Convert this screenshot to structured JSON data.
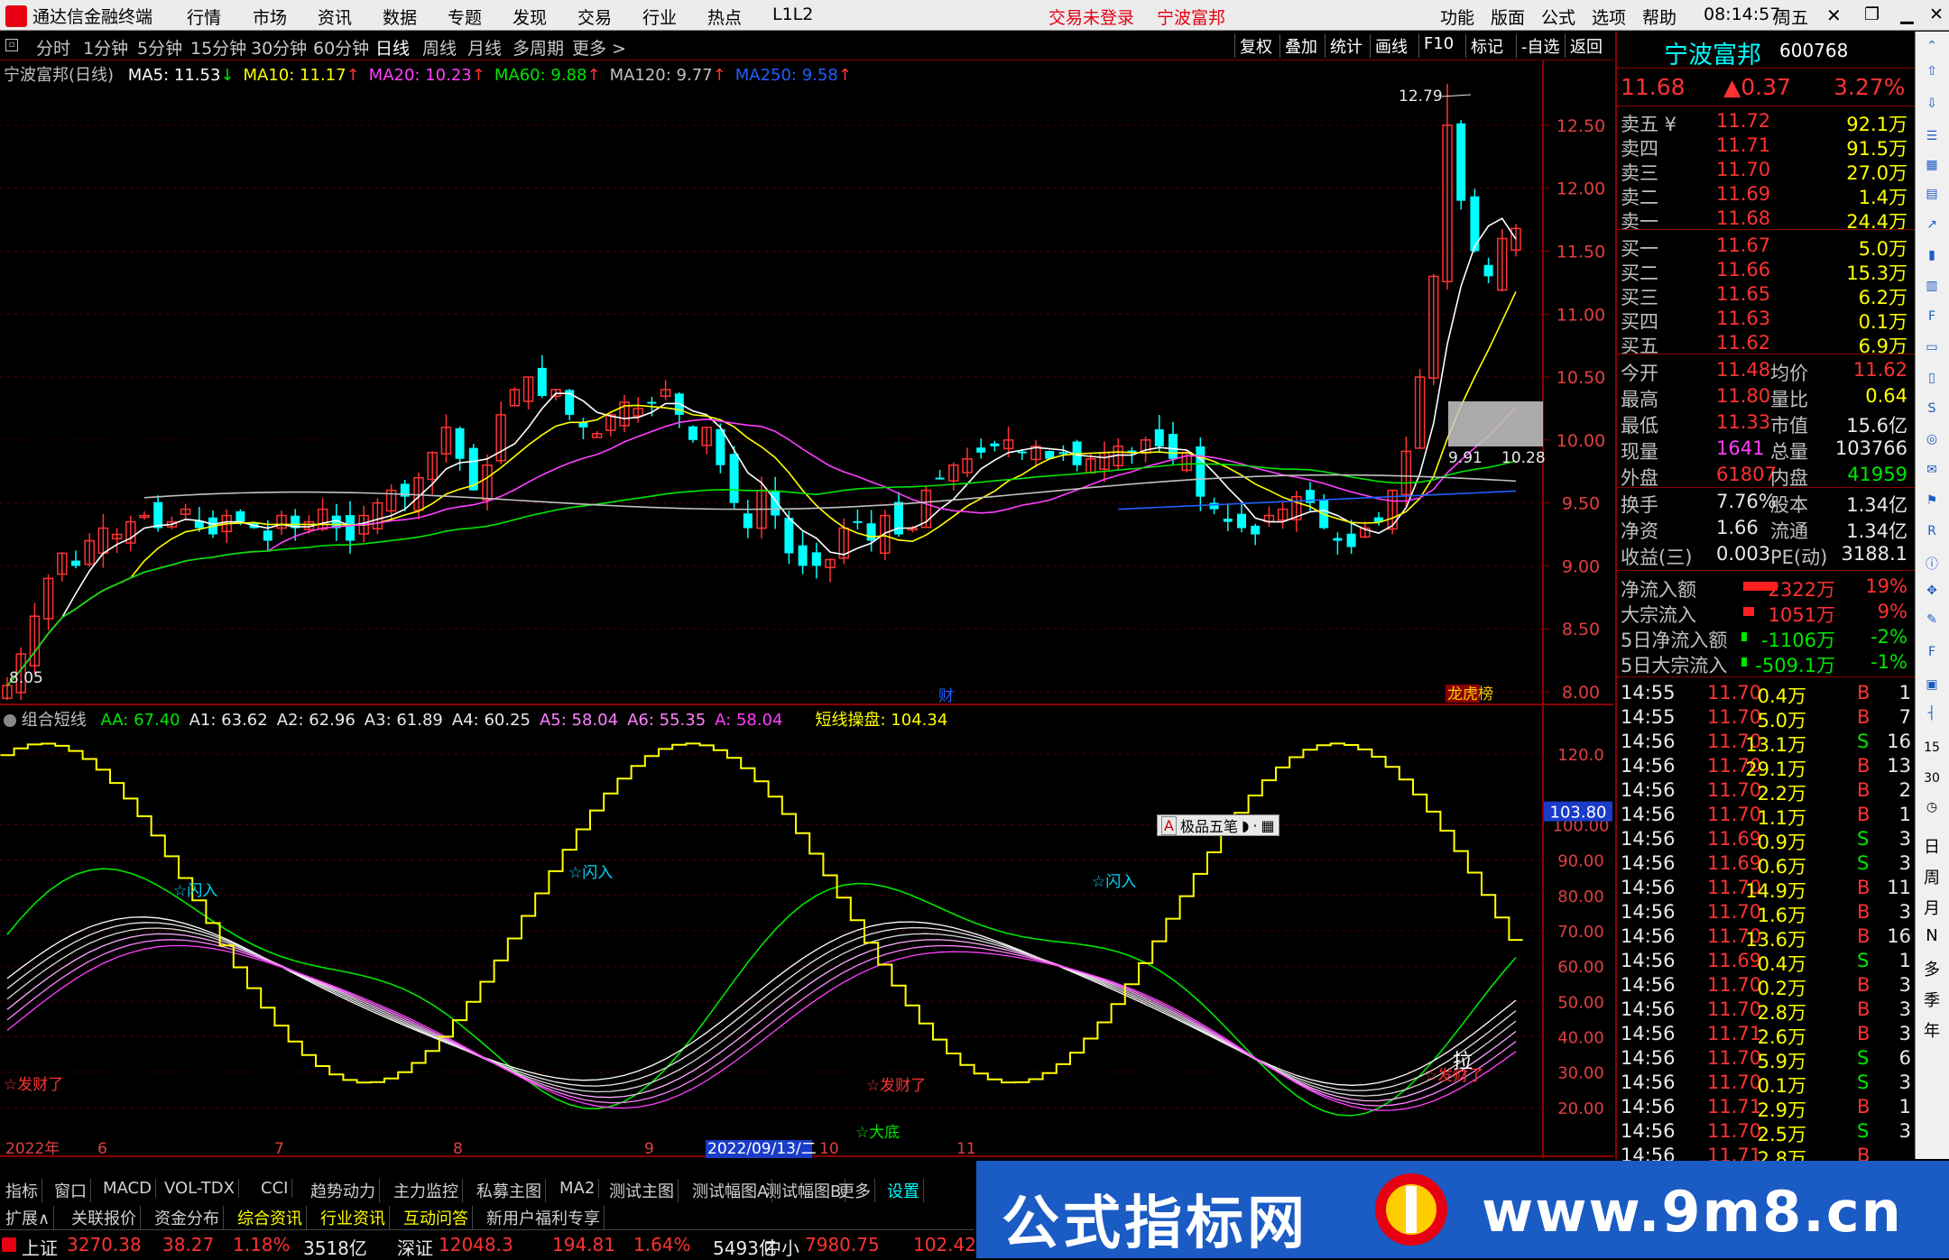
{
  "app": {
    "name": "通达信金融终端"
  },
  "menu": {
    "items": [
      "行情",
      "市场",
      "资讯",
      "数据",
      "专题",
      "发现",
      "交易",
      "行业",
      "热点",
      "L1L2"
    ],
    "alert": "交易未登录",
    "stock_link": "宁波富邦",
    "right_items": [
      "功能",
      "版面",
      "公式",
      "选项",
      "帮助"
    ],
    "time": "08:14:57",
    "weekday": "周五"
  },
  "periods": {
    "items": [
      "分时",
      "1分钟",
      "5分钟",
      "15分钟",
      "30分钟",
      "60分钟",
      "日线",
      "周线",
      "月线",
      "多周期",
      "更多 >"
    ],
    "selected": "日线",
    "right_buttons": [
      "复权",
      "叠加",
      "统计",
      "画线",
      "F10",
      "标记",
      "-自选",
      "返回"
    ]
  },
  "chart": {
    "main_label": "宁波富邦(日线)",
    "ma_items": [
      {
        "label": "MA5: 11.53",
        "arrow": "↓",
        "color": "#ffffff"
      },
      {
        "label": "MA10: 11.17",
        "arrow": "↑",
        "color": "#ffff00"
      },
      {
        "label": "MA20: 10.23",
        "arrow": "↑",
        "color": "#ff40ff"
      },
      {
        "label": "MA60: 9.88",
        "arrow": "↑",
        "color": "#00e600"
      },
      {
        "label": "MA120: 9.77",
        "arrow": "↑",
        "color": "#c0c0c0"
      },
      {
        "label": "MA250: 9.58",
        "arrow": "↑",
        "color": "#2060ff"
      }
    ],
    "price_axis": [
      "12.50",
      "12.00",
      "11.50",
      "11.00",
      "10.50",
      "10.00",
      "9.50",
      "9.00",
      "8.50",
      "8.00"
    ],
    "high_label": "12.79",
    "low_label": "8.05",
    "label_991": "9.91",
    "label_1028": "10.28",
    "marker_cai": "财",
    "marker_bang": "龙虎榜",
    "sub_label": "组合短线",
    "sub_items": [
      {
        "label": "AA: 67.40",
        "color": "#00e600"
      },
      {
        "label": "A1: 63.62",
        "color": "#e8e8e8"
      },
      {
        "label": "A2: 62.96",
        "color": "#e8e8e8"
      },
      {
        "label": "A3: 61.89",
        "color": "#e8e8e8"
      },
      {
        "label": "A4: 60.25",
        "color": "#e8e8e8"
      },
      {
        "label": "A5: 58.04",
        "color": "#ff80ff"
      },
      {
        "label": "A6: 55.35",
        "color": "#ff80ff"
      },
      {
        "label": "A: 58.04",
        "color": "#ff40ff"
      },
      {
        "label": "短线操盘: 104.34",
        "color": "#ffff00"
      }
    ],
    "sub_axis": [
      "120.0",
      "100.00",
      "90.00",
      "80.00",
      "70.00",
      "60.00",
      "50.00",
      "40.00",
      "30.00",
      "20.00"
    ],
    "sub_current": "103.80",
    "annotations": [
      "☆闪入",
      "☆闪入",
      "☆闪入",
      "☆发财了",
      "☆发财了",
      "☆发财了",
      "☆大底",
      "拉"
    ],
    "popup": "极品五笔",
    "date_axis": [
      "2022年",
      "6",
      "7",
      "8",
      "9",
      "2022/09/13/二",
      "10",
      "11"
    ]
  },
  "chart_data": {
    "type": "candlestick",
    "ylim": [
      8.0,
      12.8
    ],
    "closes": [
      8.05,
      8.3,
      8.6,
      8.9,
      9.1,
      9.0,
      9.2,
      9.3,
      9.25,
      9.35,
      9.4,
      9.3,
      9.35,
      9.45,
      9.3,
      9.25,
      9.4,
      9.35,
      9.3,
      9.2,
      9.4,
      9.3,
      9.35,
      9.45,
      9.3,
      9.2,
      9.4,
      9.5,
      9.6,
      9.55,
      9.7,
      9.9,
      10.1,
      9.85,
      9.6,
      9.8,
      10.2,
      10.4,
      10.5,
      10.35,
      10.4,
      10.2,
      10.1,
      10.05,
      10.2,
      10.3,
      10.25,
      10.3,
      10.4,
      10.2,
      10.0,
      10.1,
      9.8,
      9.5,
      9.3,
      9.6,
      9.4,
      9.1,
      9.0,
      9.0,
      9.05,
      9.3,
      9.35,
      9.2,
      9.4,
      9.25,
      9.3,
      9.6,
      9.7,
      9.8,
      9.85,
      9.9,
      9.95,
      10.0,
      9.9,
      9.95,
      9.85,
      9.9,
      9.8,
      9.85,
      9.9,
      9.95,
      9.9,
      10.0,
      9.95,
      9.85,
      9.9,
      9.55,
      9.45,
      9.35,
      9.3,
      9.25,
      9.4,
      9.45,
      9.55,
      9.5,
      9.3,
      9.2,
      9.15,
      9.3,
      9.35,
      9.6,
      9.91,
      10.5,
      11.3,
      12.5,
      11.9,
      11.5,
      11.3,
      11.6,
      11.68
    ],
    "ma_series": [
      "MA5",
      "MA10",
      "MA20",
      "MA60",
      "MA120",
      "MA250"
    ],
    "sub_series": [
      "AA",
      "A1",
      "A2",
      "A3",
      "A4",
      "A5",
      "A6",
      "A",
      "短线操盘"
    ],
    "sub_ylim": [
      10,
      130
    ]
  },
  "quote": {
    "name": "宁波富邦",
    "code": "600768",
    "price": "11.68",
    "change": "▲0.37",
    "pct": "3.27%",
    "asks": [
      {
        "label": "卖五",
        "price": "11.72",
        "vol": "92.1万"
      },
      {
        "label": "卖四",
        "price": "11.71",
        "vol": "91.5万"
      },
      {
        "label": "卖三",
        "price": "11.70",
        "vol": "27.0万"
      },
      {
        "label": "卖二",
        "price": "11.69",
        "vol": "1.4万"
      },
      {
        "label": "卖一",
        "price": "11.68",
        "vol": "24.4万"
      }
    ],
    "bids": [
      {
        "label": "买一",
        "price": "11.67",
        "vol": "5.0万"
      },
      {
        "label": "买二",
        "price": "11.66",
        "vol": "15.3万"
      },
      {
        "label": "买三",
        "price": "11.65",
        "vol": "6.2万"
      },
      {
        "label": "买四",
        "price": "11.63",
        "vol": "0.1万"
      },
      {
        "label": "买五",
        "price": "11.62",
        "vol": "6.9万"
      }
    ],
    "stats": [
      {
        "l1": "今开",
        "v1": "11.48",
        "c1": "up",
        "l2": "均价",
        "v2": "11.62",
        "c2": "up"
      },
      {
        "l1": "最高",
        "v1": "11.80",
        "c1": "up",
        "l2": "量比",
        "v2": "0.64",
        "c2": "ye"
      },
      {
        "l1": "最低",
        "v1": "11.33",
        "c1": "up",
        "l2": "市值",
        "v2": "15.6亿",
        "c2": "wh"
      },
      {
        "l1": "现量",
        "v1": "1641",
        "c1": "mg",
        "l2": "总量",
        "v2": "103766",
        "c2": "wh"
      },
      {
        "l1": "外盘",
        "v1": "61807",
        "c1": "up",
        "l2": "内盘",
        "v2": "41959",
        "c2": "dn"
      }
    ],
    "stats2": [
      {
        "l1": "换手",
        "v1": "7.76%",
        "l2": "股本",
        "v2": "1.34亿"
      },
      {
        "l1": "净资",
        "v1": "1.66",
        "l2": "流通",
        "v2": "1.34亿"
      },
      {
        "l1": "收益(三)",
        "v1": "0.003",
        "l2": "PE(动)",
        "v2": "3188.1"
      }
    ],
    "flows": [
      {
        "label": "净流入额",
        "value": "2322万",
        "pct": "19%",
        "dir": "up"
      },
      {
        "label": "大宗流入",
        "value": "1051万",
        "pct": "9%",
        "dir": "up"
      },
      {
        "label": "5日净流入额",
        "value": "-1106万",
        "pct": "-2%",
        "dir": "dn"
      },
      {
        "label": "5日大宗流入",
        "value": "-509.1万",
        "pct": "-1%",
        "dir": "dn"
      }
    ],
    "ticks": [
      {
        "t": "14:55",
        "p": "11.70",
        "v": "0.4万",
        "s": "B",
        "n": "1"
      },
      {
        "t": "14:55",
        "p": "11.70",
        "v": "5.0万",
        "s": "B",
        "n": "7"
      },
      {
        "t": "14:56",
        "p": "11.70",
        "v": "13.1万",
        "s": "S",
        "n": "16"
      },
      {
        "t": "14:56",
        "p": "11.70",
        "v": "29.1万",
        "s": "B",
        "n": "13"
      },
      {
        "t": "14:56",
        "p": "11.70",
        "v": "2.2万",
        "s": "B",
        "n": "2"
      },
      {
        "t": "14:56",
        "p": "11.70",
        "v": "1.1万",
        "s": "B",
        "n": "1"
      },
      {
        "t": "14:56",
        "p": "11.69",
        "v": "0.9万",
        "s": "S",
        "n": "3"
      },
      {
        "t": "14:56",
        "p": "11.69",
        "v": "0.6万",
        "s": "S",
        "n": "3"
      },
      {
        "t": "14:56",
        "p": "11.70",
        "v": "14.9万",
        "s": "B",
        "n": "11"
      },
      {
        "t": "14:56",
        "p": "11.70",
        "v": "1.6万",
        "s": "B",
        "n": "3"
      },
      {
        "t": "14:56",
        "p": "11.70",
        "v": "13.6万",
        "s": "B",
        "n": "16"
      },
      {
        "t": "14:56",
        "p": "11.69",
        "v": "0.4万",
        "s": "S",
        "n": "1"
      },
      {
        "t": "14:56",
        "p": "11.70",
        "v": "0.2万",
        "s": "B",
        "n": "3"
      },
      {
        "t": "14:56",
        "p": "11.70",
        "v": "2.8万",
        "s": "B",
        "n": "3"
      },
      {
        "t": "14:56",
        "p": "11.71",
        "v": "2.6万",
        "s": "B",
        "n": "3"
      },
      {
        "t": "14:56",
        "p": "11.70",
        "v": "5.9万",
        "s": "S",
        "n": "6"
      },
      {
        "t": "14:56",
        "p": "11.70",
        "v": "0.1万",
        "s": "S",
        "n": "3"
      },
      {
        "t": "14:56",
        "p": "11.71",
        "v": "2.9万",
        "s": "B",
        "n": "1"
      },
      {
        "t": "14:56",
        "p": "11.70",
        "v": "2.5万",
        "s": "S",
        "n": "3"
      },
      {
        "t": "14:56",
        "p": "11.71",
        "v": "2.8万",
        "s": "B",
        "n": ""
      }
    ]
  },
  "sidebar_labels": [
    "日",
    "周",
    "月",
    "N",
    "多",
    "季",
    "年"
  ],
  "sidebar_nums": [
    "15",
    "30"
  ],
  "bottom": {
    "tabs1": [
      "指标",
      "窗口",
      "MACD",
      "VOL-TDX",
      "CCI",
      "趋势动力",
      "主力监控",
      "私募主图",
      "MA2",
      "测试主图",
      "测试幅图A",
      "测试幅图B",
      "更多",
      "设置"
    ],
    "tabs2": [
      "扩展∧",
      "关联报价",
      "资金分布",
      "综合资讯",
      "行业资讯",
      "互动问答",
      "新用户福利专享"
    ],
    "index": [
      {
        "name": "上证",
        "value": "3270.38",
        "chg": "38.27",
        "pct": "1.18%",
        "amt": "3518亿"
      },
      {
        "name": "深证",
        "value": "12048.3",
        "chg": "194.81",
        "pct": "1.64%",
        "amt": "5493亿"
      },
      {
        "name": "中小",
        "value": "7980.75",
        "chg": "102.42",
        "pct": "",
        "amt": ""
      }
    ]
  },
  "banner": {
    "title": "公式指标网",
    "url": "www.9m8.cn"
  }
}
